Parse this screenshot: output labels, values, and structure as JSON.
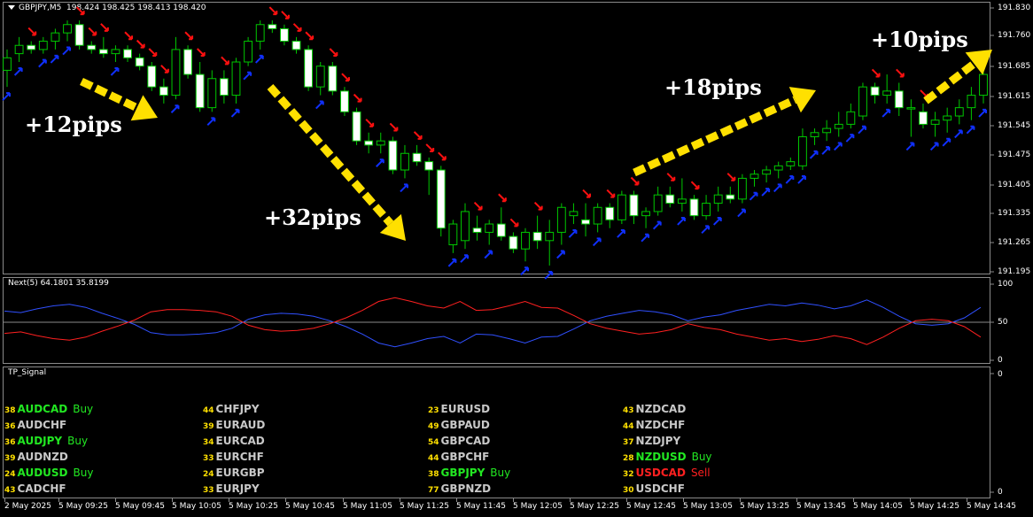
{
  "main_header": {
    "symbol": "GBPJPY,M5",
    "ohlc": "198.424 198.425 198.413 198.420"
  },
  "osc_header": "Next(5) 64.1801 35.8199",
  "sig_header": "TP_Signal",
  "price_axis": [
    "191.830",
    "191.760",
    "191.685",
    "191.615",
    "191.545",
    "191.475",
    "191.405",
    "191.335",
    "191.265",
    "191.195"
  ],
  "osc_axis": [
    "100",
    "50",
    "0"
  ],
  "sig_axis": [
    "0",
    "0"
  ],
  "time_axis": [
    "2 May 2025",
    "5 May 09:25",
    "5 May 09:45",
    "5 May 10:05",
    "5 May 10:25",
    "5 May 10:45",
    "5 May 11:05",
    "5 May 11:25",
    "5 May 11:45",
    "5 May 12:05",
    "5 May 12:25",
    "5 May 12:45",
    "5 May 13:05",
    "5 May 13:25",
    "5 May 13:45",
    "5 May 14:05",
    "5 May 14:25",
    "5 May 14:45"
  ],
  "annotations": [
    "+12pips",
    "+32pips",
    "+18pips",
    "+10pips"
  ],
  "colors": {
    "bull": "#00c800",
    "bear": "#ffffff",
    "sell_arrow": "#ff1010",
    "buy_arrow": "#1030ff",
    "blue_line": "#3050ff",
    "red_line": "#ff2020",
    "trend_arrow": "#ffe000"
  },
  "chart_data": {
    "type": "candlestick",
    "symbol": "GBPJPY",
    "timeframe": "M5",
    "ylim": [
      191.195,
      191.83
    ],
    "candles": [
      [
        191.68,
        191.73,
        191.64,
        191.71
      ],
      [
        191.72,
        191.76,
        191.7,
        191.74
      ],
      [
        191.74,
        191.75,
        191.72,
        191.73
      ],
      [
        191.73,
        191.76,
        191.72,
        191.75
      ],
      [
        191.75,
        191.78,
        191.73,
        191.77
      ],
      [
        191.77,
        191.8,
        191.75,
        191.79
      ],
      [
        191.79,
        191.8,
        191.73,
        191.74
      ],
      [
        191.74,
        191.75,
        191.72,
        191.73
      ],
      [
        191.73,
        191.76,
        191.71,
        191.72
      ],
      [
        191.72,
        191.74,
        191.7,
        191.73
      ],
      [
        191.73,
        191.74,
        191.7,
        191.71
      ],
      [
        191.71,
        191.72,
        191.68,
        191.69
      ],
      [
        191.69,
        191.7,
        191.63,
        191.64
      ],
      [
        191.64,
        191.66,
        191.6,
        191.62
      ],
      [
        191.62,
        191.76,
        191.61,
        191.73
      ],
      [
        191.73,
        191.74,
        191.66,
        191.67
      ],
      [
        191.67,
        191.7,
        191.58,
        191.59
      ],
      [
        191.59,
        191.68,
        191.58,
        191.66
      ],
      [
        191.66,
        191.68,
        191.6,
        191.62
      ],
      [
        191.62,
        191.71,
        191.6,
        191.7
      ],
      [
        191.7,
        191.76,
        191.69,
        191.75
      ],
      [
        191.75,
        191.8,
        191.73,
        191.79
      ],
      [
        191.79,
        191.8,
        191.77,
        191.78
      ],
      [
        191.78,
        191.79,
        191.74,
        191.75
      ],
      [
        191.75,
        191.76,
        191.72,
        191.73
      ],
      [
        191.73,
        191.74,
        191.63,
        191.64
      ],
      [
        191.64,
        191.7,
        191.62,
        191.69
      ],
      [
        191.69,
        191.7,
        191.62,
        191.63
      ],
      [
        191.63,
        191.64,
        191.57,
        191.58
      ],
      [
        191.58,
        191.59,
        191.5,
        191.51
      ],
      [
        191.51,
        191.53,
        191.48,
        191.5
      ],
      [
        191.5,
        191.53,
        191.48,
        191.51
      ],
      [
        191.51,
        191.52,
        191.43,
        191.44
      ],
      [
        191.44,
        191.5,
        191.42,
        191.48
      ],
      [
        191.48,
        191.5,
        191.45,
        191.46
      ],
      [
        191.46,
        191.47,
        191.38,
        191.44
      ],
      [
        191.44,
        191.45,
        191.28,
        191.3
      ],
      [
        191.26,
        191.32,
        191.24,
        191.31
      ],
      [
        191.27,
        191.36,
        191.25,
        191.34
      ],
      [
        191.3,
        191.33,
        191.27,
        191.29
      ],
      [
        191.29,
        191.32,
        191.26,
        191.31
      ],
      [
        191.31,
        191.35,
        191.27,
        191.28
      ],
      [
        191.28,
        191.29,
        191.24,
        191.25
      ],
      [
        191.25,
        191.3,
        191.22,
        191.29
      ],
      [
        191.29,
        191.33,
        191.25,
        191.27
      ],
      [
        191.27,
        191.32,
        191.21,
        191.29
      ],
      [
        191.29,
        191.36,
        191.26,
        191.35
      ],
      [
        191.33,
        191.36,
        191.31,
        191.34
      ],
      [
        191.32,
        191.36,
        191.28,
        191.31
      ],
      [
        191.31,
        191.36,
        191.29,
        191.35
      ],
      [
        191.35,
        191.36,
        191.3,
        191.32
      ],
      [
        191.32,
        191.39,
        191.31,
        191.38
      ],
      [
        191.38,
        191.39,
        191.31,
        191.33
      ],
      [
        191.33,
        191.35,
        191.3,
        191.34
      ],
      [
        191.34,
        191.4,
        191.33,
        191.38
      ],
      [
        191.38,
        191.4,
        191.35,
        191.36
      ],
      [
        191.36,
        191.42,
        191.34,
        191.37
      ],
      [
        191.37,
        191.38,
        191.32,
        191.33
      ],
      [
        191.33,
        191.38,
        191.32,
        191.36
      ],
      [
        191.36,
        191.4,
        191.34,
        191.38
      ],
      [
        191.38,
        191.4,
        191.36,
        191.37
      ],
      [
        191.37,
        191.43,
        191.36,
        191.42
      ],
      [
        191.42,
        191.44,
        191.4,
        191.43
      ],
      [
        191.43,
        191.45,
        191.41,
        191.44
      ],
      [
        191.44,
        191.46,
        191.42,
        191.45
      ],
      [
        191.45,
        191.47,
        191.44,
        191.46
      ],
      [
        191.45,
        191.54,
        191.44,
        191.52
      ],
      [
        191.52,
        191.54,
        191.5,
        191.53
      ],
      [
        191.53,
        191.56,
        191.51,
        191.54
      ],
      [
        191.54,
        191.58,
        191.52,
        191.55
      ],
      [
        191.55,
        191.6,
        191.54,
        191.58
      ],
      [
        191.57,
        191.65,
        191.56,
        191.64
      ],
      [
        191.64,
        191.65,
        191.6,
        191.62
      ],
      [
        191.62,
        191.67,
        191.6,
        191.63
      ],
      [
        191.63,
        191.65,
        191.57,
        191.59
      ],
      [
        191.59,
        191.61,
        191.52,
        191.59
      ],
      [
        191.58,
        191.6,
        191.54,
        191.55
      ],
      [
        191.55,
        191.58,
        191.52,
        191.56
      ],
      [
        191.56,
        191.59,
        191.53,
        191.57
      ],
      [
        191.57,
        191.61,
        191.55,
        191.59
      ],
      [
        191.59,
        191.64,
        191.56,
        191.62
      ],
      [
        191.62,
        191.7,
        191.6,
        191.67
      ]
    ],
    "osc_series": [
      {
        "name": "blue",
        "ylim": [
          0,
          100
        ],
        "values": [
          65,
          63,
          68,
          72,
          74,
          70,
          62,
          55,
          47,
          36,
          33,
          33,
          34,
          36,
          42,
          54,
          60,
          62,
          61,
          58,
          52,
          44,
          34,
          22,
          17,
          22,
          28,
          31,
          22,
          34,
          33,
          28,
          22,
          30,
          31,
          41,
          52,
          58,
          62,
          66,
          64,
          60,
          52,
          57,
          60,
          66,
          70,
          74,
          72,
          76,
          73,
          68,
          72,
          80,
          70,
          58,
          48,
          46,
          48,
          56,
          70
        ]
      },
      {
        "name": "red",
        "ylim": [
          0,
          100
        ],
        "values": [
          35,
          37,
          32,
          28,
          26,
          30,
          38,
          45,
          53,
          64,
          67,
          67,
          66,
          64,
          58,
          46,
          40,
          38,
          39,
          42,
          48,
          56,
          66,
          78,
          83,
          78,
          72,
          69,
          78,
          66,
          67,
          72,
          78,
          70,
          69,
          59,
          48,
          42,
          38,
          34,
          36,
          40,
          48,
          43,
          40,
          34,
          30,
          26,
          28,
          24,
          27,
          32,
          28,
          20,
          30,
          42,
          52,
          54,
          52,
          44,
          30
        ]
      }
    ]
  },
  "signals": [
    {
      "n": "38",
      "pair": "AUDCAD",
      "state": "buy",
      "action": "Buy"
    },
    {
      "n": "36",
      "pair": "AUDCHF",
      "state": "none",
      "action": ""
    },
    {
      "n": "36",
      "pair": "AUDJPY",
      "state": "buy",
      "action": "Buy"
    },
    {
      "n": "39",
      "pair": "AUDNZD",
      "state": "none",
      "action": ""
    },
    {
      "n": "24",
      "pair": "AUDUSD",
      "state": "buy",
      "action": "Buy"
    },
    {
      "n": "43",
      "pair": "CADCHF",
      "state": "none",
      "action": ""
    },
    {
      "n": "44",
      "pair": "CHFJPY",
      "state": "none",
      "action": ""
    },
    {
      "n": "39",
      "pair": "EURAUD",
      "state": "none",
      "action": ""
    },
    {
      "n": "34",
      "pair": "EURCAD",
      "state": "none",
      "action": ""
    },
    {
      "n": "33",
      "pair": "EURCHF",
      "state": "none",
      "action": ""
    },
    {
      "n": "24",
      "pair": "EURGBP",
      "state": "none",
      "action": ""
    },
    {
      "n": "33",
      "pair": "EURJPY",
      "state": "none",
      "action": ""
    },
    {
      "n": "23",
      "pair": "EURUSD",
      "state": "none",
      "action": ""
    },
    {
      "n": "49",
      "pair": "GBPAUD",
      "state": "none",
      "action": ""
    },
    {
      "n": "54",
      "pair": "GBPCAD",
      "state": "none",
      "action": ""
    },
    {
      "n": "44",
      "pair": "GBPCHF",
      "state": "none",
      "action": ""
    },
    {
      "n": "38",
      "pair": "GBPJPY",
      "state": "buy",
      "action": "Buy"
    },
    {
      "n": "77",
      "pair": "GBPNZD",
      "state": "none",
      "action": ""
    },
    {
      "n": "43",
      "pair": "NZDCAD",
      "state": "none",
      "action": ""
    },
    {
      "n": "44",
      "pair": "NZDCHF",
      "state": "none",
      "action": ""
    },
    {
      "n": "37",
      "pair": "NZDJPY",
      "state": "none",
      "action": ""
    },
    {
      "n": "28",
      "pair": "NZDUSD",
      "state": "buy",
      "action": "Buy"
    },
    {
      "n": "32",
      "pair": "USDCAD",
      "state": "sell",
      "action": "Sell"
    },
    {
      "n": "30",
      "pair": "USDCHF",
      "state": "none",
      "action": ""
    }
  ]
}
